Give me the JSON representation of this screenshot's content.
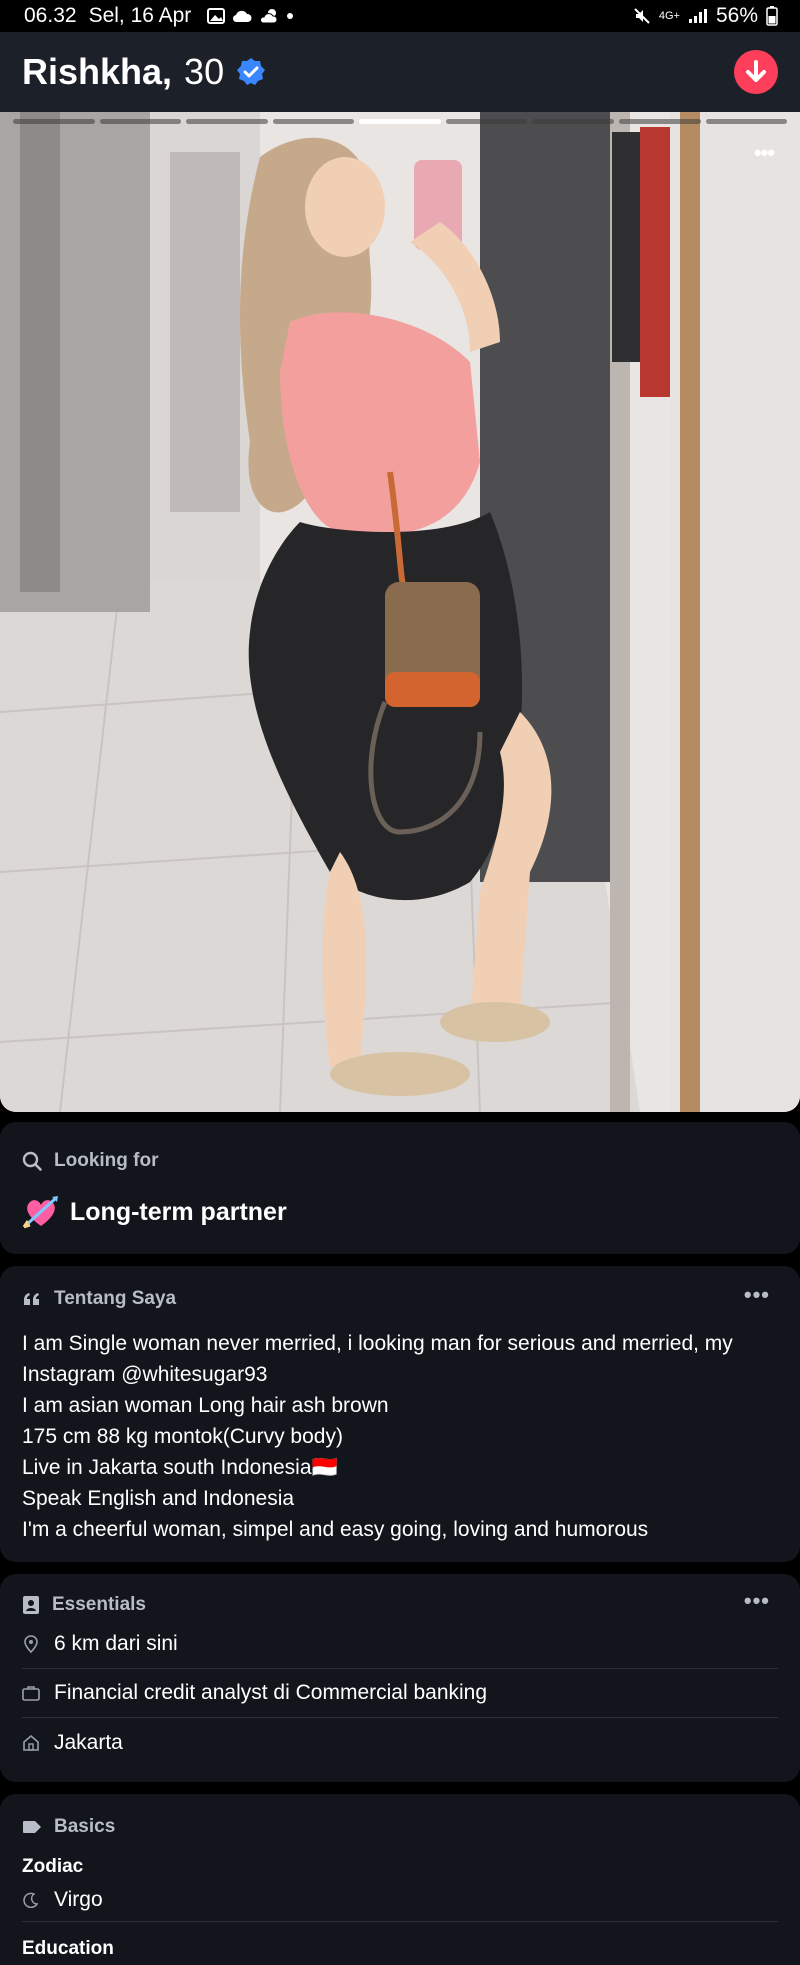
{
  "status_bar": {
    "time": "06.32",
    "date": "Sel, 16 Apr",
    "network": "4G+",
    "battery": "56%"
  },
  "profile": {
    "name": "Rishkha,",
    "age": "30"
  },
  "photo": {
    "segments": 9,
    "active_segment": 5
  },
  "looking_for": {
    "label": "Looking for",
    "value": "Long-term partner"
  },
  "about": {
    "label": "Tentang Saya",
    "lines": [
      "I am Single woman never merried, i looking man for serious and merried, my Instagram @whitesugar93",
      "I am asian woman Long hair ash brown",
      "175 cm 88 kg montok(Curvy body)",
      "Live in Jakarta south Indonesia🇮🇩",
      "Speak English and Indonesia",
      "I'm a cheerful woman, simpel and easy going, loving and humorous"
    ]
  },
  "essentials": {
    "label": "Essentials",
    "items": [
      {
        "icon": "location-pin-icon",
        "text": "6 km dari sini"
      },
      {
        "icon": "briefcase-icon",
        "text": "Financial credit analyst di Commercial banking"
      },
      {
        "icon": "home-icon",
        "text": "Jakarta"
      }
    ]
  },
  "basics": {
    "label": "Basics",
    "zodiac_label": "Zodiac",
    "zodiac_value": "Virgo",
    "education_label": "Education"
  },
  "colors": {
    "accent": "#fd3f5b",
    "verified": "#3a86ff",
    "card_bg": "#12151b",
    "header_bg": "#1c2029"
  }
}
